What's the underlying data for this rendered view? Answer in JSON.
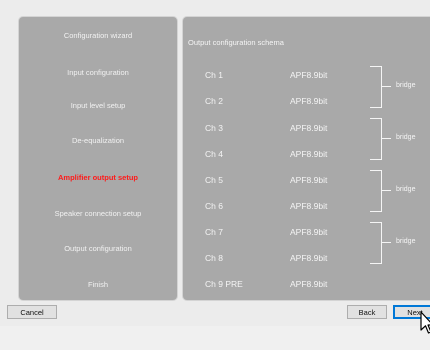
{
  "wizard_steps": [
    {
      "label": "Configuration wizard",
      "active": false
    },
    {
      "label": "Input configuration",
      "active": false
    },
    {
      "label": "Input level setup",
      "active": false
    },
    {
      "label": "De-equalization",
      "active": false
    },
    {
      "label": "Amplifier output setup",
      "active": true
    },
    {
      "label": "Speaker connection setup",
      "active": false
    },
    {
      "label": "Output configuration",
      "active": false
    },
    {
      "label": "Finish",
      "active": false
    }
  ],
  "schema": {
    "title": "Output configuration schema",
    "channels": [
      {
        "label": "Ch 1",
        "model": "APF8.9bit"
      },
      {
        "label": "Ch 2",
        "model": "APF8.9bit"
      },
      {
        "label": "Ch 3",
        "model": "APF8.9bit"
      },
      {
        "label": "Ch 4",
        "model": "APF8.9bit"
      },
      {
        "label": "Ch 5",
        "model": "APF8.9bit"
      },
      {
        "label": "Ch 6",
        "model": "APF8.9bit"
      },
      {
        "label": "Ch 7",
        "model": "APF8.9bit"
      },
      {
        "label": "Ch 8",
        "model": "APF8.9bit"
      },
      {
        "label": "Ch 9  PRE",
        "model": "APF8.9bit"
      }
    ],
    "bridges": [
      "bridge",
      "bridge",
      "bridge",
      "bridge"
    ]
  },
  "buttons": {
    "cancel": "Cancel",
    "back": "Back",
    "next": "Next"
  },
  "colors": {
    "panel": "#a9a9a9",
    "active_step": "#ff1a1a",
    "text": "#f5f5f5",
    "default_button_border": "#0078d7"
  },
  "icons": {
    "cursor": "mouse-pointer-icon"
  }
}
